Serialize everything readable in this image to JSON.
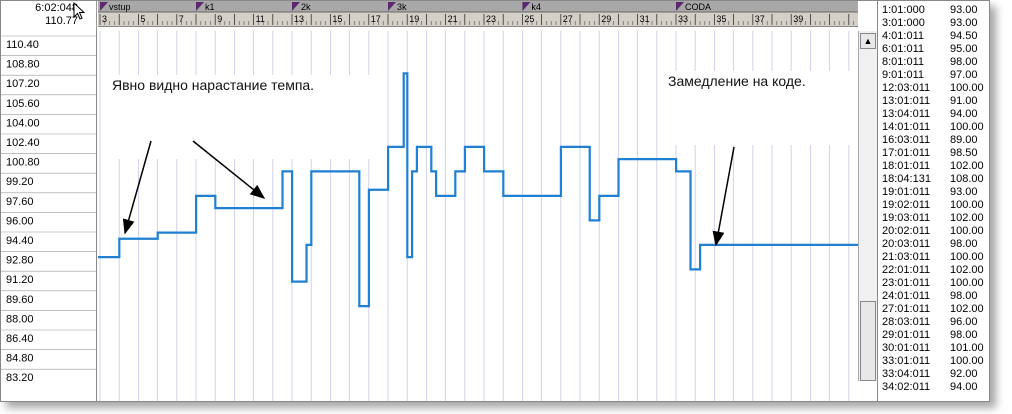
{
  "readout": {
    "time": "6:02:048",
    "value": "110.77"
  },
  "ruler": {
    "markers": [
      "vstup",
      "k1",
      "2k",
      "3k",
      "k4",
      "CODA"
    ],
    "bars": [
      "3",
      "5",
      "7",
      "9",
      "11",
      "13",
      "15",
      "17",
      "19",
      "21",
      "23",
      "25",
      "27",
      "29",
      "31",
      "33",
      "35",
      "37",
      "39"
    ]
  },
  "y_axis_labels": [
    "110.40",
    "108.80",
    "107.20",
    "105.60",
    "104.00",
    "102.40",
    "100.80",
    "99.20",
    "97.60",
    "96.00",
    "94.40",
    "92.80",
    "91.20",
    "89.60",
    "88.00",
    "86.40",
    "84.80",
    "83.20"
  ],
  "annotations": {
    "left": "Явно видно нарастание темпа.",
    "right": "Замедление на коде."
  },
  "tempo_list": [
    {
      "pos": "1:01:000",
      "bpm": "93.00"
    },
    {
      "pos": "3:01:000",
      "bpm": "93.00"
    },
    {
      "pos": "4:01:011",
      "bpm": "94.50"
    },
    {
      "pos": "6:01:011",
      "bpm": "95.00"
    },
    {
      "pos": "8:01:011",
      "bpm": "98.00"
    },
    {
      "pos": "9:01:011",
      "bpm": "97.00"
    },
    {
      "pos": "12:03:011",
      "bpm": "100.00"
    },
    {
      "pos": "13:01:011",
      "bpm": "91.00"
    },
    {
      "pos": "13:04:011",
      "bpm": "94.00"
    },
    {
      "pos": "14:01:011",
      "bpm": "100.00"
    },
    {
      "pos": "16:03:011",
      "bpm": "89.00"
    },
    {
      "pos": "17:01:011",
      "bpm": "98.50"
    },
    {
      "pos": "18:01:011",
      "bpm": "102.00"
    },
    {
      "pos": "18:04:131",
      "bpm": "108.00"
    },
    {
      "pos": "19:01:011",
      "bpm": "93.00"
    },
    {
      "pos": "19:02:011",
      "bpm": "100.00"
    },
    {
      "pos": "19:03:011",
      "bpm": "102.00"
    },
    {
      "pos": "20:02:011",
      "bpm": "100.00"
    },
    {
      "pos": "20:03:011",
      "bpm": "98.00"
    },
    {
      "pos": "21:03:011",
      "bpm": "100.00"
    },
    {
      "pos": "22:01:011",
      "bpm": "102.00"
    },
    {
      "pos": "23:01:011",
      "bpm": "100.00"
    },
    {
      "pos": "24:01:011",
      "bpm": "98.00"
    },
    {
      "pos": "27:01:011",
      "bpm": "102.00"
    },
    {
      "pos": "28:03:011",
      "bpm": "96.00"
    },
    {
      "pos": "29:01:011",
      "bpm": "98.00"
    },
    {
      "pos": "30:01:011",
      "bpm": "101.00"
    },
    {
      "pos": "33:01:011",
      "bpm": "100.00"
    },
    {
      "pos": "33:04:011",
      "bpm": "92.00"
    },
    {
      "pos": "34:02:011",
      "bpm": "94.00"
    }
  ],
  "colors": {
    "tempo_line": "#1f7fd0",
    "grid": "#c8c8e8",
    "marker": "#5a2a6e"
  }
}
